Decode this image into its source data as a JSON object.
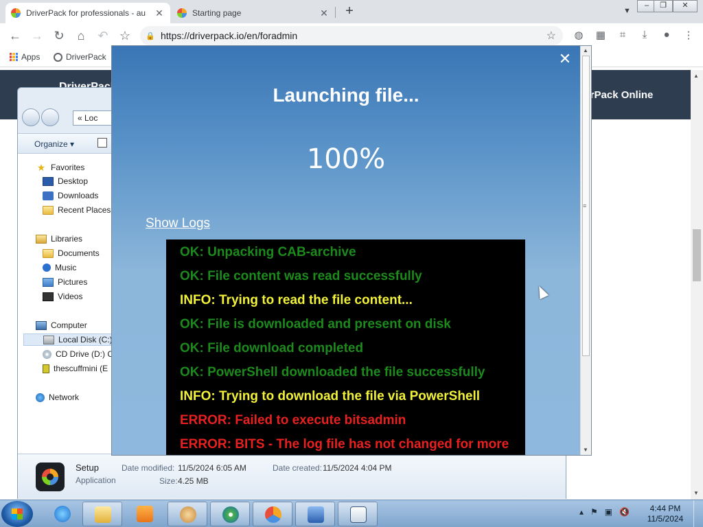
{
  "browser": {
    "tabs": [
      {
        "label": "DriverPack for professionals - au"
      },
      {
        "label": "Starting page"
      }
    ],
    "url": "https://driverpack.io/en/foradmin",
    "bookmarks": [
      {
        "label": "Apps"
      },
      {
        "label": "DriverPack"
      }
    ]
  },
  "site": {
    "brand": "DriverPack",
    "link": "verPack Online"
  },
  "explorer": {
    "address": "« Loc",
    "organize": "Organize",
    "tree": [
      {
        "label": "Favorites"
      },
      {
        "label": "Desktop"
      },
      {
        "label": "Downloads"
      },
      {
        "label": "Recent Places"
      },
      {
        "label": "Libraries"
      },
      {
        "label": "Documents"
      },
      {
        "label": "Music"
      },
      {
        "label": "Pictures"
      },
      {
        "label": "Videos"
      },
      {
        "label": "Computer"
      },
      {
        "label": "Local Disk (C:)"
      },
      {
        "label": "CD Drive (D:) C"
      },
      {
        "label": "thescuffmini (E"
      },
      {
        "label": "Network"
      }
    ],
    "details": {
      "name": "Setup",
      "type": "Application",
      "modified_label": "Date modified:",
      "modified_value": "11/5/2024 6:05 AM",
      "created_label": "Date created:",
      "created_value": "11/5/2024 4:04 PM",
      "size_label": "Size:",
      "size_value": "4.25 MB"
    }
  },
  "modal": {
    "title": "Launching file...",
    "progress": "100%",
    "show_logs": "Show Logs",
    "logs": [
      {
        "text": "OK: Unpacking CAB-archive",
        "level": "ok"
      },
      {
        "text": "OK: File content was read successfully",
        "level": "ok"
      },
      {
        "text": "INFO: Trying to read the file content...",
        "level": "info"
      },
      {
        "text": "OK: File is downloaded and present on disk",
        "level": "ok"
      },
      {
        "text": "OK: File download completed",
        "level": "ok"
      },
      {
        "text": "OK: PowerShell downloaded the file successfully",
        "level": "ok"
      },
      {
        "text": "INFO: Trying to download the file via PowerShell",
        "level": "info"
      },
      {
        "text": "ERROR: Failed to execute bitsadmin",
        "level": "error"
      },
      {
        "text": "ERROR: BITS - The log file has not changed for more",
        "level": "error"
      }
    ],
    "colors": {
      "ok": "#1c8a1c",
      "info": "#f2f23a",
      "error": "#e82020"
    }
  },
  "taskbar": {
    "time": "4:44 PM",
    "date": "11/5/2024",
    "apps": [
      {
        "icon": "internet-explorer-icon"
      },
      {
        "icon": "file-explorer-icon"
      },
      {
        "icon": "media-player-icon"
      },
      {
        "icon": "paint-icon"
      },
      {
        "icon": "cd-burner-icon"
      },
      {
        "icon": "chrome-icon"
      },
      {
        "icon": "app-icon"
      },
      {
        "icon": "setup-window-icon"
      }
    ]
  }
}
